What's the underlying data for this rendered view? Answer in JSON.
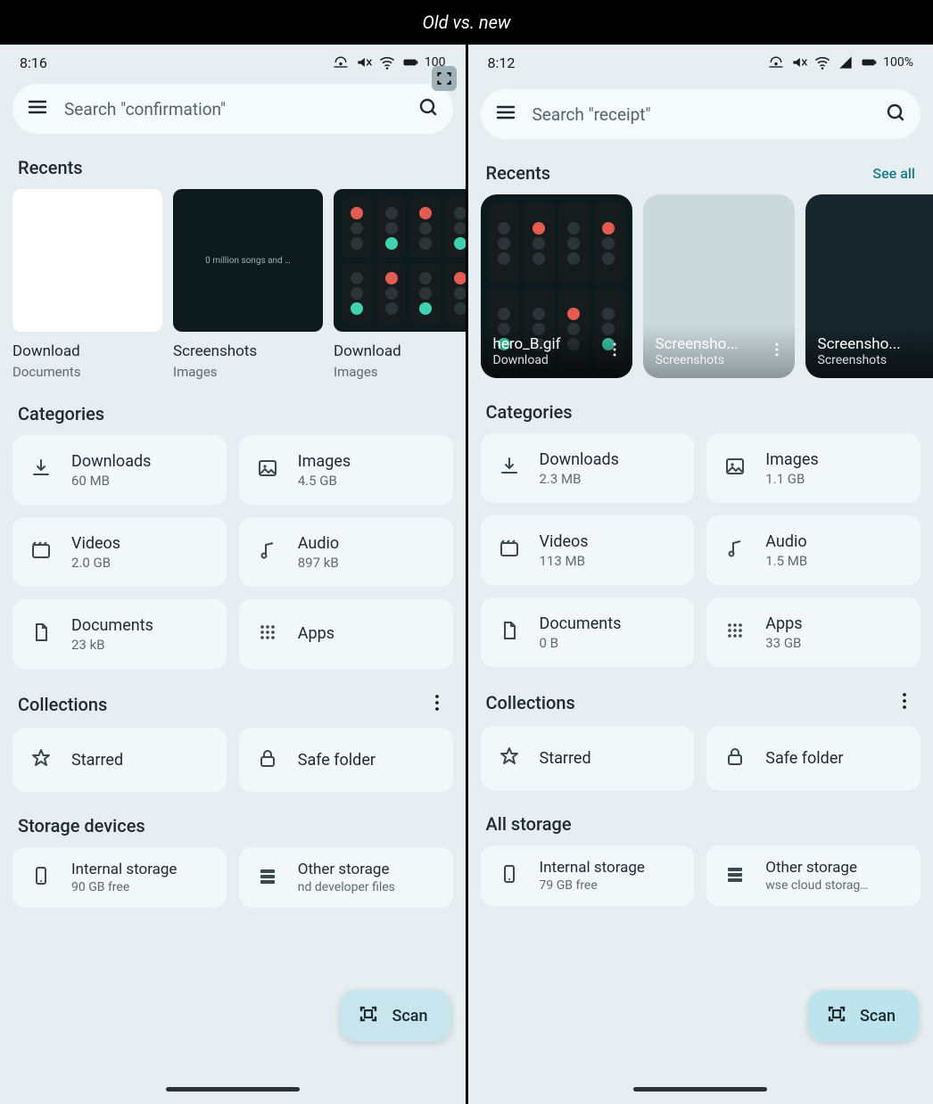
{
  "header": {
    "title": "Old vs. new"
  },
  "left": {
    "status": {
      "time": "8:16",
      "battery": "100"
    },
    "search": {
      "placeholder": "Search \"confirmation\""
    },
    "recents": {
      "title": "Recents",
      "items": [
        {
          "name": "Download",
          "sub": "Documents",
          "thumb": "white"
        },
        {
          "name": "Screenshots",
          "sub": "Images",
          "thumb": "dark-text"
        },
        {
          "name": "Download",
          "sub": "Images",
          "thumb": "lights"
        }
      ]
    },
    "categories": {
      "title": "Categories",
      "items": [
        {
          "name": "Downloads",
          "sub": "60 MB"
        },
        {
          "name": "Images",
          "sub": "4.5 GB"
        },
        {
          "name": "Videos",
          "sub": "2.0 GB"
        },
        {
          "name": "Audio",
          "sub": "897 kB"
        },
        {
          "name": "Documents",
          "sub": "23 kB"
        },
        {
          "name": "Apps",
          "sub": ""
        }
      ]
    },
    "collections": {
      "title": "Collections",
      "items": [
        {
          "name": "Starred"
        },
        {
          "name": "Safe folder"
        }
      ]
    },
    "storage": {
      "title": "Storage devices",
      "items": [
        {
          "name": "Internal storage",
          "sub": "90 GB free"
        },
        {
          "name": "Other storage",
          "sub": "nd developer files"
        }
      ]
    },
    "scan_label": "Scan"
  },
  "right": {
    "status": {
      "time": "8:12",
      "battery": "100%"
    },
    "search": {
      "placeholder": "Search \"receipt\""
    },
    "recents": {
      "title": "Recents",
      "see_all": "See all",
      "items": [
        {
          "name": "hero_B.gif",
          "sub": "Download",
          "style": "lights"
        },
        {
          "name": "Screensho...",
          "sub": "Screenshots",
          "style": "light"
        },
        {
          "name": "Screensho...",
          "sub": "Screenshots",
          "style": "dark"
        }
      ]
    },
    "categories": {
      "title": "Categories",
      "items": [
        {
          "name": "Downloads",
          "sub": "2.3 MB"
        },
        {
          "name": "Images",
          "sub": "1.1 GB"
        },
        {
          "name": "Videos",
          "sub": "113 MB"
        },
        {
          "name": "Audio",
          "sub": "1.5 MB"
        },
        {
          "name": "Documents",
          "sub": "0 B"
        },
        {
          "name": "Apps",
          "sub": "33 GB"
        }
      ]
    },
    "collections": {
      "title": "Collections",
      "items": [
        {
          "name": "Starred"
        },
        {
          "name": "Safe folder"
        }
      ]
    },
    "storage": {
      "title": "All storage",
      "items": [
        {
          "name": "Internal storage",
          "sub": "79 GB free"
        },
        {
          "name": "Other storage",
          "sub": "wse cloud storage a"
        }
      ]
    },
    "scan_label": "Scan"
  }
}
